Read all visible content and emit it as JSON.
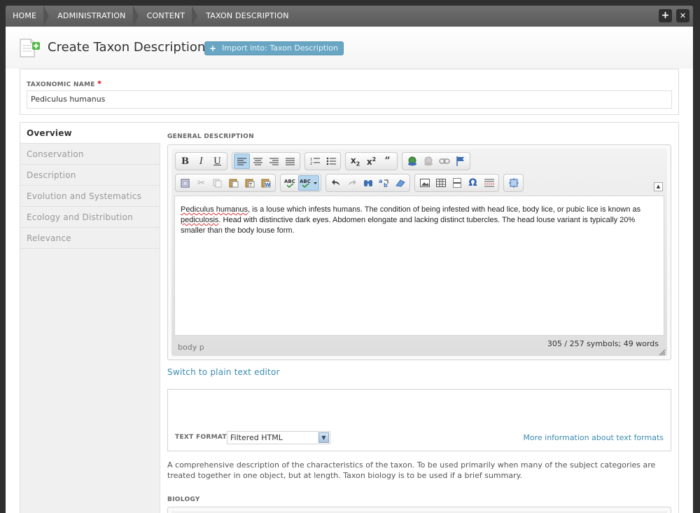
{
  "breadcrumb": [
    "HOME",
    "ADMINISTRATION",
    "CONTENT",
    "TAXON DESCRIPTION"
  ],
  "top_buttons": {
    "add": "+",
    "close": "✕"
  },
  "header": {
    "title": "Create Taxon Description",
    "import_button": "Import into: Taxon Description",
    "import_plus": "+"
  },
  "taxonomic_name": {
    "label": "TAXONOMIC NAME",
    "required": "*",
    "value": "Pediculus humanus"
  },
  "tabs": [
    {
      "label": "Overview",
      "active": true
    },
    {
      "label": "Conservation"
    },
    {
      "label": "Description"
    },
    {
      "label": "Evolution and Systematics"
    },
    {
      "label": "Ecology and Distribution"
    },
    {
      "label": "Relevance"
    }
  ],
  "general_description": {
    "label": "GENERAL DESCRIPTION",
    "text_parts": [
      {
        "text": "Pediculus humanus",
        "misspelled": true
      },
      {
        "text": ", is a louse which infests humans. The condition of being infested with head lice, body lice, or pubic lice is known as "
      },
      {
        "text": "pediculosis",
        "misspelled": true
      },
      {
        "text": ". Head with distinctive dark eyes. Abdomen elongate and lacking distinct tubercles. The head louse variant is typically 20% smaller than the body louse form."
      }
    ],
    "path": "body   p",
    "count": "305 / 257 symbols; 49 words",
    "switch_link": "Switch to plain text editor"
  },
  "text_format": {
    "label": "TEXT FORMAT",
    "selected": "Filtered HTML",
    "info_link": "More information about text formats"
  },
  "help_text": "A comprehensive description of the characteristics of the taxon. To be used primarily when many of the subject categories are treated together in one object, but at length. Taxon biology is to be used if a brief summary.",
  "biology_label": "BIOLOGY",
  "toolbar": {
    "row1": [
      [
        "bold-icon",
        "italic-icon",
        "underline-icon"
      ],
      [
        "align-left-icon",
        "align-center-icon",
        "align-right-icon",
        "align-justify-icon"
      ],
      [
        "numbered-list-icon",
        "bulleted-list-icon"
      ],
      [
        "subscript-icon",
        "superscript-icon",
        "blockquote-icon"
      ],
      [
        "link-icon",
        "unlink-icon",
        "chain-icon",
        "anchor-flag-icon"
      ]
    ],
    "row2": [
      [
        "select-all-icon",
        "cut-icon",
        "copy-icon",
        "paste-icon",
        "paste-text-icon",
        "paste-word-icon"
      ],
      [
        "spellcheck-icon",
        "spellcheck-as-you-type-icon"
      ],
      [
        "undo-icon",
        "redo-icon",
        "find-icon",
        "replace-icon",
        "remove-format-icon"
      ],
      [
        "image-icon",
        "table-icon",
        "horizontal-rule-icon",
        "special-char-icon",
        "page-break-icon"
      ],
      [
        "maximize-icon"
      ]
    ]
  }
}
